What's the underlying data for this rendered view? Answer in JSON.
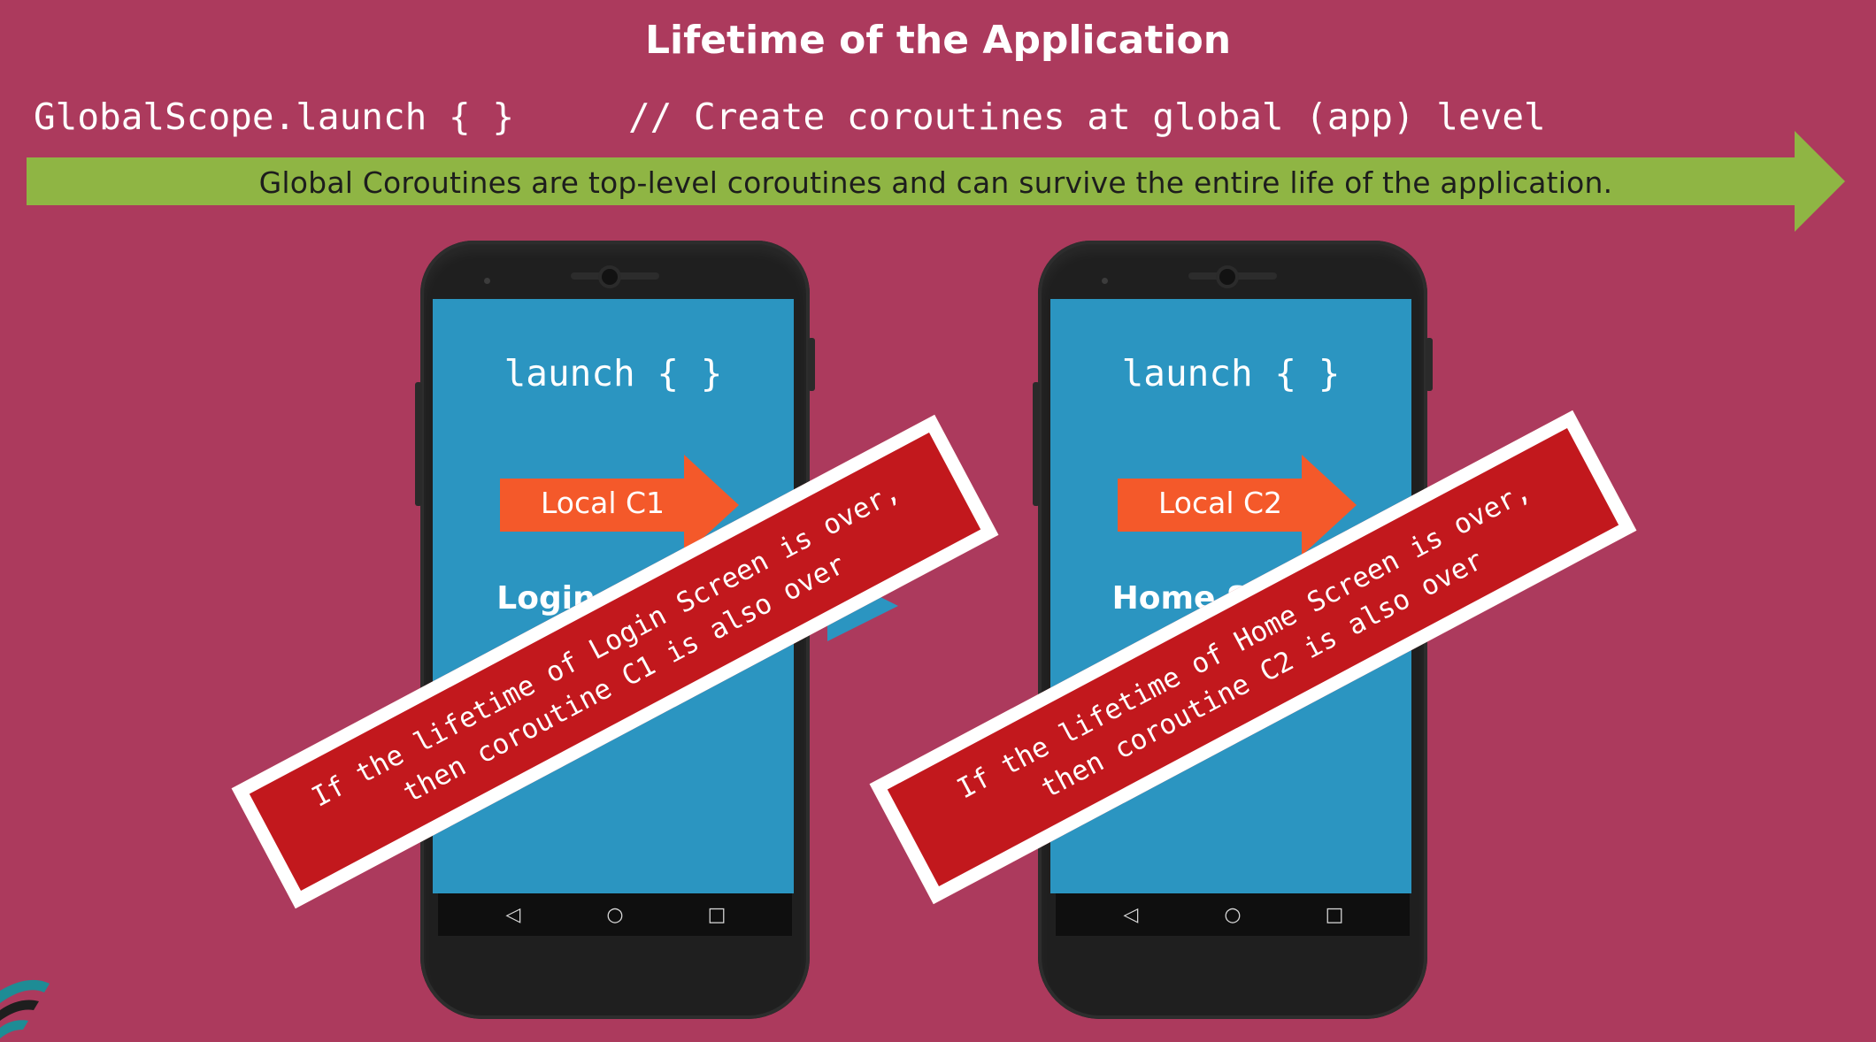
{
  "header": {
    "title": "Lifetime of the Application",
    "code_statement": "GlobalScope.launch { }",
    "code_comment": "// Create coroutines at global (app) level"
  },
  "global_banner": {
    "text": "Global Coroutines are top-level coroutines and can survive the entire life of the application.",
    "color": "#8fb544"
  },
  "phones": [
    {
      "launch_code": "launch { }",
      "local_label": "Local C1",
      "screen_label": "Login Screen",
      "note_line1": "If the lifetime of Login Screen is over,",
      "note_line2": "then coroutine C1 is also over"
    },
    {
      "launch_code": "launch { }",
      "local_label": "Local C2",
      "screen_label": "Home Screen",
      "note_line1": "If the lifetime of Home Screen is over,",
      "note_line2": "then coroutine C2 is also over"
    }
  ],
  "nav_icons": [
    "back-triangle-icon",
    "home-circle-icon",
    "recent-square-icon"
  ],
  "colors": {
    "background": "#ac3a5d",
    "screen": "#2b95c1",
    "local_arrow": "#f4592a",
    "note": "#c2181d",
    "banner": "#8fb544"
  }
}
